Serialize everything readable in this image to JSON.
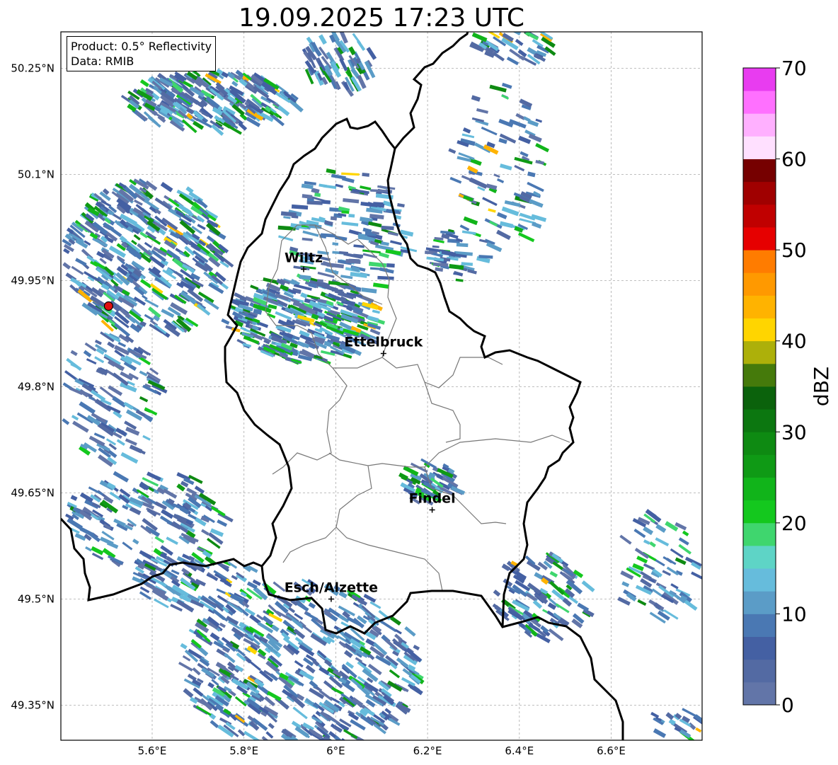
{
  "title": "19.09.2025 17:23 UTC",
  "info_box": {
    "product": "Product: 0.5° Reflectivity",
    "data": "Data: RMIB"
  },
  "map": {
    "lon_range": [
      5.4,
      6.8
    ],
    "lat_range": [
      49.3,
      50.28
    ],
    "lat_ticks": [
      {
        "value": 50.25,
        "label": "50.25°N"
      },
      {
        "value": 50.1,
        "label": "50.1°N"
      },
      {
        "value": 49.95,
        "label": "49.95°N"
      },
      {
        "value": 49.8,
        "label": "49.8°N"
      },
      {
        "value": 49.65,
        "label": "49.65°N"
      },
      {
        "value": 49.5,
        "label": "49.5°N"
      },
      {
        "value": 49.35,
        "label": "49.35°N"
      }
    ],
    "lon_ticks": [
      {
        "value": 5.6,
        "label": "5.6°E"
      },
      {
        "value": 5.8,
        "label": "5.8°E"
      },
      {
        "value": 6.0,
        "label": "6°E"
      },
      {
        "value": 6.2,
        "label": "6.2°E"
      },
      {
        "value": 6.4,
        "label": "6.4°E"
      },
      {
        "value": 6.6,
        "label": "6.6°E"
      }
    ],
    "grid": true,
    "cities": [
      {
        "name": "Wiltz",
        "lon": 5.93,
        "lat": 49.966
      },
      {
        "name": "Ettelbruck",
        "lon": 6.104,
        "lat": 49.847
      },
      {
        "name": "Findel",
        "lon": 6.21,
        "lat": 49.626
      },
      {
        "name": "Esch/Alzette",
        "lon": 5.99,
        "lat": 49.5
      }
    ],
    "radar_site": {
      "lon": 5.505,
      "lat": 49.914,
      "color": "#e01010"
    }
  },
  "colorbar": {
    "label": "dBZ",
    "min": 0,
    "max": 70,
    "ticks": [
      "0",
      "10",
      "20",
      "30",
      "40",
      "50",
      "60",
      "70"
    ],
    "colors": [
      "#6275a8",
      "#536aa3",
      "#4460a3",
      "#4a78b3",
      "#5b9cc7",
      "#66bcdc",
      "#5ed4c6",
      "#3fd66e",
      "#14c81e",
      "#11b41a",
      "#0f9a15",
      "#0e8a12",
      "#0c7710",
      "#0b620c",
      "#457a0b",
      "#adb00a",
      "#ffd500",
      "#ffb300",
      "#ff9900",
      "#ff7c00",
      "#e60000",
      "#c00000",
      "#a00000",
      "#760000",
      "#ffe0ff",
      "#ffb0ff",
      "#ff70ff",
      "#e83cf0"
    ]
  }
}
